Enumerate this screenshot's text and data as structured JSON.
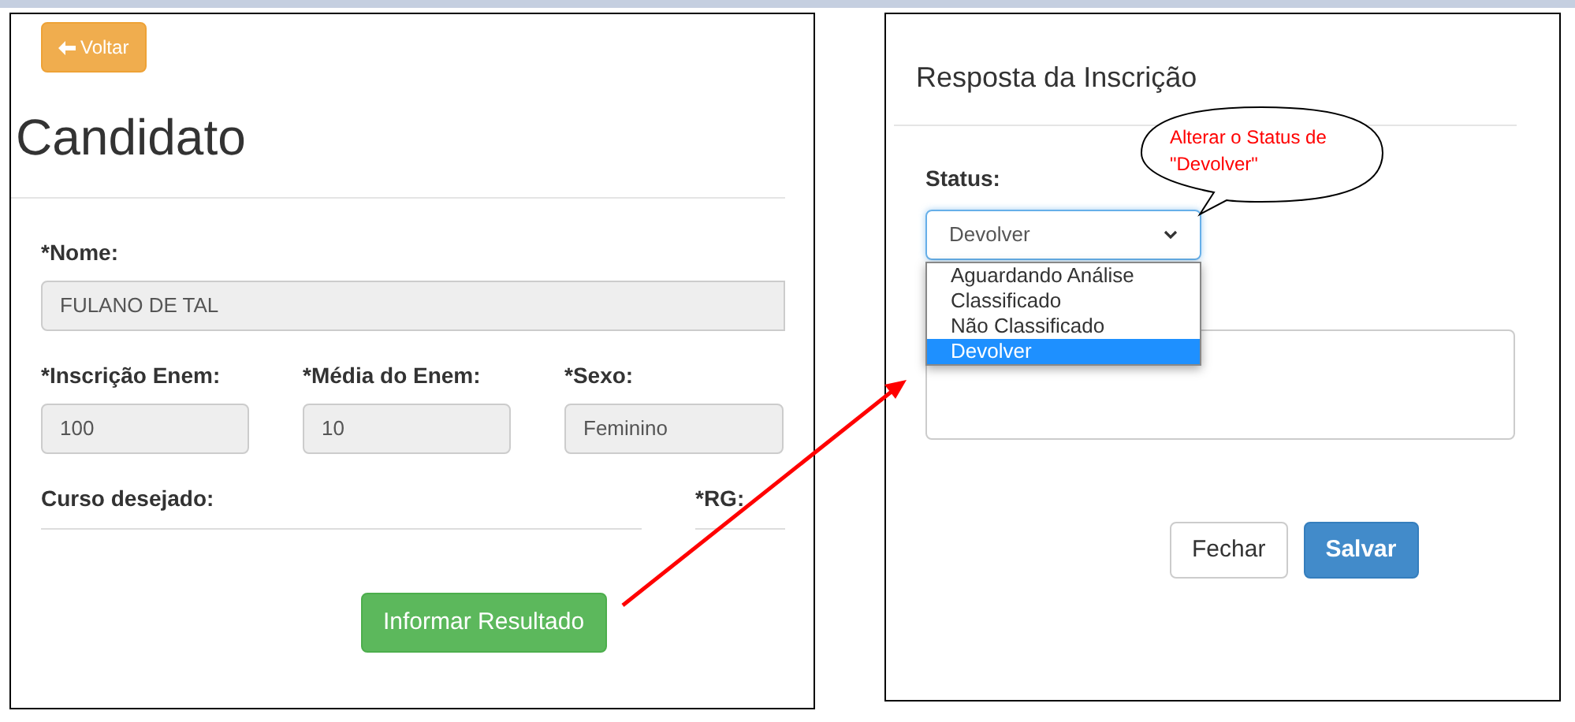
{
  "back_button": {
    "label": "Voltar"
  },
  "candidate": {
    "title": "Candidato",
    "name_field": {
      "label": "*Nome:",
      "value": "FULANO DE TAL"
    },
    "row_fields": [
      {
        "label": "*Inscrição Enem:",
        "value": "100"
      },
      {
        "label": "*Média do Enem:",
        "value": "10"
      },
      {
        "label": "*Sexo:",
        "value": "Feminino"
      }
    ],
    "course_label": "Curso desejado:",
    "rg_label": "*RG:",
    "result_button": "Informar Resultado"
  },
  "modal": {
    "title": "Resposta da Inscrição",
    "status_label": "Status:",
    "select": {
      "value": "Devolver",
      "options": [
        {
          "label": "Aguardando Análise",
          "selected": false
        },
        {
          "label": "Classificado",
          "selected": false
        },
        {
          "label": "Não Classificado",
          "selected": false
        },
        {
          "label": "Devolver",
          "selected": true
        }
      ]
    },
    "buttons": [
      {
        "label": "Fechar",
        "kind": "default"
      },
      {
        "label": "Salvar",
        "kind": "primary"
      }
    ]
  },
  "callout": {
    "text": "Alterar o Status de \"Devolver\""
  }
}
